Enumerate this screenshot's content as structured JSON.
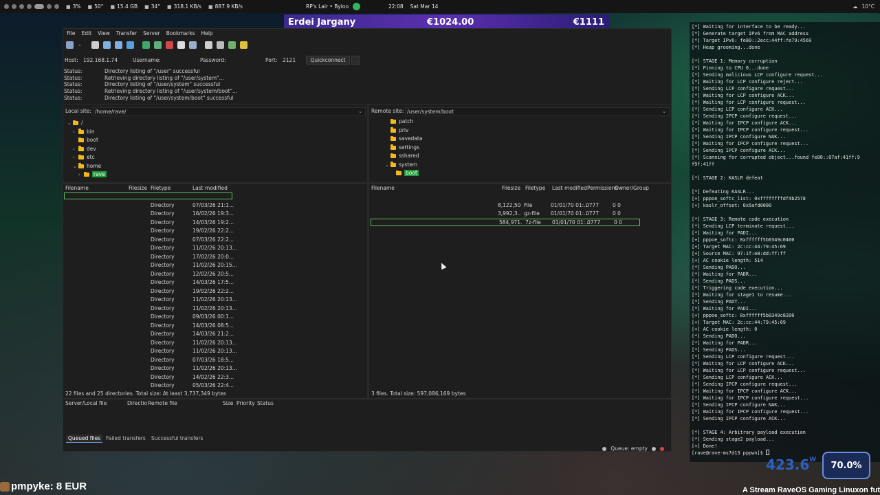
{
  "topbar": {
    "stats": [
      {
        "icon": "cpu-icon",
        "text": "3%"
      },
      {
        "icon": "thermometer-icon",
        "text": "50°"
      },
      {
        "icon": "memory-icon",
        "text": "15.4 GB"
      },
      {
        "icon": "gpu-icon",
        "text": "34°"
      },
      {
        "icon": "network-icon",
        "text": "318.1 KB/s"
      },
      {
        "icon": "network-icon",
        "text": "887.9 KB/s"
      }
    ],
    "window_title": "RP's Lair • Byloo",
    "time": "22:08",
    "date": "Sat Mar 14",
    "weather": "10°C"
  },
  "banner": {
    "name": "Erdei Jargany",
    "amount": "€1024.00",
    "goal": "€1111"
  },
  "filezilla": {
    "menu": [
      "File",
      "Edit",
      "View",
      "Transfer",
      "Server",
      "Bookmarks",
      "Help"
    ],
    "quickconnect": {
      "host_label": "Host:",
      "host_value": "192.168.1.74",
      "user_label": "Username:",
      "pass_label": "Password:",
      "port_label": "Port:",
      "port_value": "2121",
      "button": "Quickconnect"
    },
    "log": [
      {
        "k": "Status:",
        "v": "Directory listing of \"/user\" successful"
      },
      {
        "k": "Status:",
        "v": "Retrieving directory listing of \"/user/system\"..."
      },
      {
        "k": "Status:",
        "v": "Directory listing of \"/user/system\" successful"
      },
      {
        "k": "Status:",
        "v": "Retrieving directory listing of \"/user/system/boot\"..."
      },
      {
        "k": "Status:",
        "v": "Directory listing of \"/user/system/boot\" successful"
      }
    ],
    "local": {
      "label": "Local site:",
      "path": "/home/rave/",
      "tree": [
        {
          "name": "/",
          "chev": "⌄"
        },
        {
          "name": "bin",
          "chev": "›"
        },
        {
          "name": "boot",
          "chev": ""
        },
        {
          "name": "dev",
          "chev": "›"
        },
        {
          "name": "etc",
          "chev": "›"
        },
        {
          "name": "home",
          "chev": "⌄"
        },
        {
          "name": "rave",
          "chev": "›"
        }
      ],
      "columns": [
        "Filename",
        "Filesize",
        "Filetype",
        "Last modified"
      ],
      "rows": [
        {
          "name": "..",
          "size": "",
          "type": "",
          "mod": ""
        },
        {
          "name": ".cache",
          "size": "",
          "type": "Directory",
          "mod": "07/03/26 21:1..."
        },
        {
          "name": ".cargo",
          "size": "",
          "type": "Directory",
          "mod": "16/02/26 19:3..."
        },
        {
          "name": ".config",
          "size": "",
          "type": "Directory",
          "mod": "14/03/26 19:2..."
        },
        {
          "name": ".icons",
          "size": "",
          "type": "Directory",
          "mod": "19/02/26 22:2..."
        },
        {
          "name": ".librewolf",
          "size": "",
          "type": "Directory",
          "mod": "07/03/26 22:2..."
        },
        {
          "name": ".local",
          "size": "",
          "type": "Directory",
          "mod": "11/02/26 20:13..."
        },
        {
          "name": ".mozilla",
          "size": "",
          "type": "Directory",
          "mod": "17/02/26 20:0..."
        },
        {
          "name": ".pki",
          "size": "",
          "type": "Directory",
          "mod": "11/02/26 20:15..."
        },
        {
          "name": ".ssh",
          "size": "",
          "type": "Directory",
          "mod": "12/02/26 20:5..."
        },
        {
          "name": ".steam",
          "size": "",
          "type": "Directory",
          "mod": "14/03/26 17:5..."
        },
        {
          "name": ".themes",
          "size": "",
          "type": "Directory",
          "mod": "19/02/26 22:2..."
        },
        {
          "name": ".var",
          "size": "",
          "type": "Directory",
          "mod": "11/02/26 20:13..."
        },
        {
          "name": ".vscode-oss",
          "size": "",
          "type": "Directory",
          "mod": "11/02/26 20:13..."
        },
        {
          "name": "Desktop",
          "size": "",
          "type": "Directory",
          "mod": "09/03/26 00:1..."
        },
        {
          "name": "Documents",
          "size": "",
          "type": "Directory",
          "mod": "14/03/26 08:5..."
        },
        {
          "name": "Downloads",
          "size": "",
          "type": "Directory",
          "mod": "14/03/26 21:2..."
        },
        {
          "name": "Games",
          "size": "",
          "type": "Directory",
          "mod": "11/02/26 20:13..."
        },
        {
          "name": "Music",
          "size": "",
          "type": "Directory",
          "mod": "11/02/26 20:13..."
        },
        {
          "name": "PPPwn",
          "size": "",
          "type": "Directory",
          "mod": "07/03/26 18:5..."
        },
        {
          "name": "Pictures",
          "size": "",
          "type": "Directory",
          "mod": "11/02/26 20:13..."
        },
        {
          "name": "Rave-Hyprland",
          "size": "",
          "type": "Directory",
          "mod": "14/02/26 22:3..."
        },
        {
          "name": "RaveOS2.0-Beta",
          "size": "",
          "type": "Directory",
          "mod": "05/03/26 22:4..."
        }
      ],
      "status": "22 files and 25 directories. Total size: At least 3,737,349 bytes"
    },
    "remote": {
      "label": "Remote site:",
      "path": "/user/system/boot",
      "tree": [
        {
          "name": "patch",
          "chev": ""
        },
        {
          "name": "priv",
          "chev": ""
        },
        {
          "name": "savedata",
          "chev": ""
        },
        {
          "name": "settings",
          "chev": ""
        },
        {
          "name": "sshared",
          "chev": ""
        },
        {
          "name": "system",
          "chev": "⌄"
        },
        {
          "name": "boot",
          "chev": ""
        }
      ],
      "columns": [
        "Filename",
        "Filesize",
        "Filetype",
        "Last modified",
        "Permissions",
        "Owner/Group"
      ],
      "rows": [
        {
          "name": "..",
          "size": "",
          "type": "",
          "mod": "",
          "perm": "",
          "owner": "",
          "kind": "folder"
        },
        {
          "name": "bzImage",
          "size": "8,122,504",
          "type": "File",
          "mod": "01/01/70 01:...",
          "perm": "0777",
          "owner": "0 0",
          "kind": "file"
        },
        {
          "name": "initramfs.cpio.gz",
          "size": "3,992,3...",
          "type": "gz-file",
          "mod": "01/01/70 01:...",
          "perm": "0777",
          "owner": "0 0",
          "kind": "archive"
        },
        {
          "name": "mesa-ps4-25.3.0-devel-trixie.7z",
          "size": "584,971...",
          "type": "7z-file",
          "mod": "01/01/70 01:...",
          "perm": "0777",
          "owner": "0 0",
          "kind": "archive"
        }
      ],
      "status": "3 files. Total size: 597,086,169 bytes"
    },
    "queue": {
      "columns": [
        "Server/Local file",
        "Directio",
        "Remote file",
        "Size",
        "Priority",
        "Status"
      ],
      "tabs": [
        "Queued files",
        "Failed transfers",
        "Successful transfers"
      ],
      "status": "Queue: empty"
    }
  },
  "terminal": {
    "lines": [
      "[*] Waiting for interface to be ready...",
      "[*] Generate target IPv6 from MAC address",
      "[*] Target IPv6: fe80::2ecc:44ff:fe79:4569",
      "[*] Heap grooming...done",
      "",
      "[*] STAGE 1: Memory corruption",
      "[*] Pinning to CPU 0...done",
      "[*] Sending malicious LCP configure request...",
      "[*] Waiting for LCP configure reject...",
      "[*] Sending LCP configure request...",
      "[*] Waiting for LCP configure ACK...",
      "[*] Waiting for LCP configure request...",
      "[*] Sending LCP configure ACK...",
      "[*] Sending IPCP configure request...",
      "[*] Waiting for IPCP configure ACK...",
      "[*] Waiting for IPCP configure request...",
      "[*] Sending IPCP configure NAK...",
      "[*] Waiting for IPCP configure request...",
      "[*] Sending IPCP configure ACK...",
      "[*] Scanning for corrupted object...found fe80::07af:41ff:9",
      "f9f:41ff",
      "",
      "[*] STAGE 2: KASLR defeat",
      "",
      "[*] Defeating KASLR...",
      "[+] pppoe_softc_list: 0xffffffffdf4b2578",
      "[+] kaslr_offset: 0x5afd0000",
      "",
      "[*] STAGE 3: Remote code execution",
      "[*] Sending LCP terminate request...",
      "[*] Waiting for PADI...",
      "[+] pppoe_softc: 0xffffff5b0349c0400",
      "[+] Target MAC: 2c:cc:44:79:45:69",
      "[+] Source MAC: 97:1f:e8:dd:ff:ff",
      "[+] AC cookie length: 514",
      "[*] Sending PADO...",
      "[*] Waiting for PADR...",
      "[*] Sending PADS...",
      "[*] Triggering code execution...",
      "[*] Waiting for stage1 to resume...",
      "[*] Sending PADT...",
      "[*] Waiting for PADI...",
      "[+] pppoe_softc: 0xffffff5b0349c8200",
      "[+] Target MAC: 2c:cc:44:79:45:69",
      "[+] AC cookie length: 0",
      "[*] Sending PADO...",
      "[*] Waiting for PADR...",
      "[*] Sending PADS...",
      "[*] Sending LCP configure request...",
      "[*] Waiting for LCP configure ACK...",
      "[*] Waiting for LCP configure request...",
      "[*] Sending LCP configure ACK...",
      "[*] Sending IPCP configure request...",
      "[*] Waiting for IPCP configure ACK...",
      "[*] Waiting for IPCP configure request...",
      "[*] Sending IPCP configure NAK...",
      "[*] Waiting for IPCP configure request...",
      "[*] Sending IPCP configure ACK...",
      "",
      "[*] STAGE 4: Arbitrary payload execution",
      "[*] Sending stage2 payload...",
      "[+] Done!",
      "[rave@rave-ms7d13 pppwn]$ "
    ]
  },
  "overlays": {
    "power": "423.6",
    "power_unit": "W",
    "percent": "70.0%",
    "donor": "pmpyke: 8 EUR",
    "ticker": "A Stream RaveOS Gaming Linuxon fut"
  },
  "colors": {
    "highlight": "#1f9a3a",
    "folder": "#f2b81e",
    "banner": "#4a2aa0",
    "terminal_accent": "#7ad06a"
  }
}
